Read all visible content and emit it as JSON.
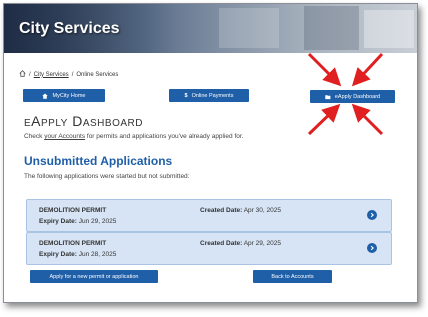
{
  "banner": {
    "title": "City Services"
  },
  "breadcrumb": {
    "home_icon": "home-icon",
    "city_services": "City Services",
    "sep1": "/",
    "sep2": "/",
    "online_services": "Online Services"
  },
  "nav": {
    "mycity_home": "MyCity Home",
    "online_payments": "Online Payments",
    "eapply_dashboard": "eApply Dashboard"
  },
  "page": {
    "title": "eApply Dashboard",
    "subtitle_pre": "Check",
    "subtitle_link": "your Accounts",
    "subtitle_post": "for permits and applications you've already applied for."
  },
  "unsubmitted": {
    "heading": "Unsubmitted Applications",
    "description": "The following applications were started but not submitted:",
    "items": [
      {
        "name": "DEMOLITION PERMIT",
        "expiry_label": "Expiry Date:",
        "expiry": "Jun 29, 2025",
        "created_label": "Created Date:",
        "created": "Apr 30, 2025"
      },
      {
        "name": "DEMOLITION PERMIT",
        "expiry_label": "Expiry Date:",
        "expiry": "Jun 28, 2025",
        "created_label": "Created Date:",
        "created": "Apr 29, 2025"
      }
    ]
  },
  "actions": {
    "apply_new": "Apply for a new permit or application",
    "back_to_accounts": "Back to Accounts"
  },
  "colors": {
    "primary": "#1f5fa8",
    "card_bg": "#d6e4f5",
    "annotation": "#e02020"
  }
}
